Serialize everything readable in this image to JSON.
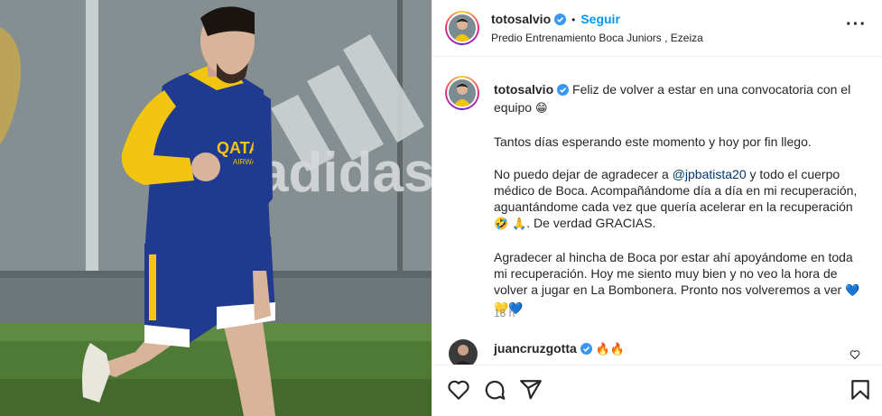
{
  "post": {
    "username": "totosalvio",
    "follow_label": "Seguir",
    "location": "Predio Entrenamiento Boca Juniors , Ezeiza",
    "more_label": "···",
    "photo_text": {
      "jersey_sponsor_1": "QATAR",
      "jersey_sponsor_2": "AIRWAYS",
      "banner_logo": "adidas"
    }
  },
  "caption": {
    "username": "totosalvio",
    "p1": "Feliz de volver a estar en una convocatoria con el equipo",
    "p1_emoji": "😁",
    "p2": "Tantos días esperando este momento y hoy por fin llego.",
    "p3_before": "No puedo dejar de agradecer a ",
    "p3_mention": "@jpbatista20",
    "p3_after": " y todo el cuerpo médico de Boca. Acompañándome día a día en mi recuperación, aguantándome cada vez que quería acelerar en la recuperación ",
    "p3_emoji1": "🤣",
    "p3_emoji2": "🙏",
    "p3_end": ". De verdad GRACIAS.",
    "p4": "Agradecer al hincha de Boca por estar ahí apoyándome en toda mi recuperación. Hoy me siento muy bien y no veo la hora de volver a jugar en La Bombonera. Pronto nos volveremos a ver ",
    "p4_emoji": "💙💛💙",
    "time": "18 h"
  },
  "comment": {
    "username": "juancruzgotta",
    "text": "🔥🔥"
  },
  "colors": {
    "accent": "#0095f6",
    "verified": "#3897f0",
    "boca_blue": "#1f3a8f",
    "boca_yellow": "#f2c511"
  },
  "icons": [
    "verified-icon",
    "more-icon",
    "heart-icon",
    "comment-icon",
    "share-icon",
    "bookmark-icon"
  ]
}
